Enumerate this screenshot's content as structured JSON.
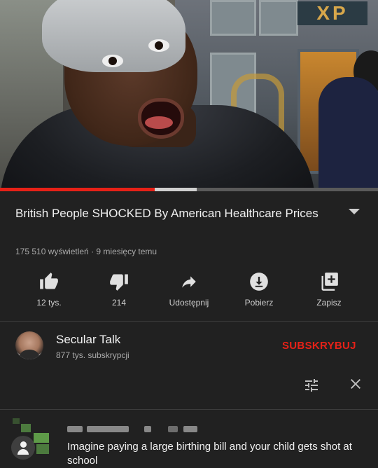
{
  "video": {
    "title": "British People SHOCKED By American Healthcare Prices",
    "meta": "175 510 wyświetleń · 9 miesięcy temu",
    "storefront_sign": "XP",
    "progress": {
      "played": 0.41,
      "buffered": 0.52
    }
  },
  "actions": [
    {
      "label": "12 tys.",
      "icon": "thumb-up-icon"
    },
    {
      "label": "214",
      "icon": "thumb-down-icon"
    },
    {
      "label": "Udostępnij",
      "icon": "share-icon"
    },
    {
      "label": "Pobierz",
      "icon": "download-icon"
    },
    {
      "label": "Zapisz",
      "icon": "add-to-playlist-icon"
    }
  ],
  "channel": {
    "name": "Secular Talk",
    "subscribers": "877 tys. subskrypcji",
    "subscribe_label": "SUBSKRYBUJ"
  },
  "comments": {
    "first": {
      "text": "Imagine paying a large birthing bill and your child gets shot at school"
    }
  },
  "colors": {
    "background": "#212121",
    "accent": "#e62117",
    "secondary_text": "#aaaaaa"
  }
}
